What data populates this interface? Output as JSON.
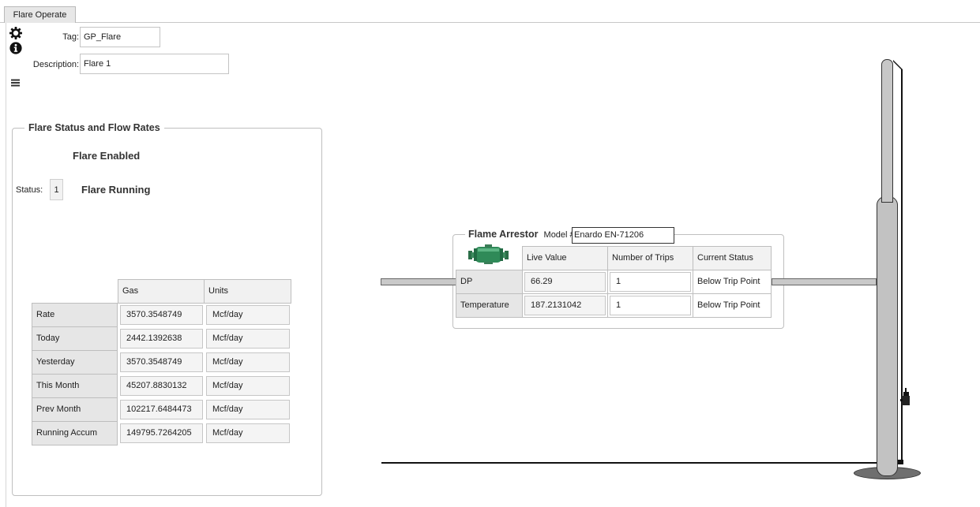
{
  "tabs": [
    {
      "label": "Flare Operate"
    }
  ],
  "fields": {
    "tag_label": "Tag:",
    "tag_value": "GP_Flare",
    "description_label": "Description:",
    "description_value": "Flare 1"
  },
  "icons": {
    "settings": "gear-icon",
    "info": "info-icon",
    "menu": "hamburger-menu-icon"
  },
  "flare_status": {
    "legend": "Flare Status and Flow Rates",
    "enabled_text": "Flare Enabled",
    "status_label": "Status:",
    "status_value": "1",
    "running_text": "Flare Running",
    "columns": [
      "Gas",
      "Units"
    ],
    "rows": [
      {
        "label": "Rate",
        "gas": "3570.3548749",
        "units": "Mcf/day"
      },
      {
        "label": "Today",
        "gas": "2442.1392638",
        "units": "Mcf/day"
      },
      {
        "label": "Yesterday",
        "gas": "3570.3548749",
        "units": "Mcf/day"
      },
      {
        "label": "This Month",
        "gas": "45207.8830132",
        "units": "Mcf/day"
      },
      {
        "label": "Prev Month",
        "gas": "102217.6484473",
        "units": "Mcf/day"
      },
      {
        "label": "Running Accum",
        "gas": "149795.7264205",
        "units": "Mcf/day"
      }
    ]
  },
  "flame_arrestor": {
    "legend": "Flame Arrestor",
    "model_label": "Model #",
    "model_value": "Enardo EN-71206",
    "columns": [
      "Live Value",
      "Number of Trips",
      "Current Status"
    ],
    "rows": [
      {
        "label": "DP",
        "live_value": "66.29",
        "trips": "1",
        "status": "Below Trip Point"
      },
      {
        "label": "Temperature",
        "live_value": "187.2131042",
        "trips": "1",
        "status": "Below Trip Point"
      }
    ]
  },
  "colors": {
    "pipe": "#c9c9c9",
    "stack": "#c4c4c4",
    "arrestor_body": "#2e8b57"
  }
}
